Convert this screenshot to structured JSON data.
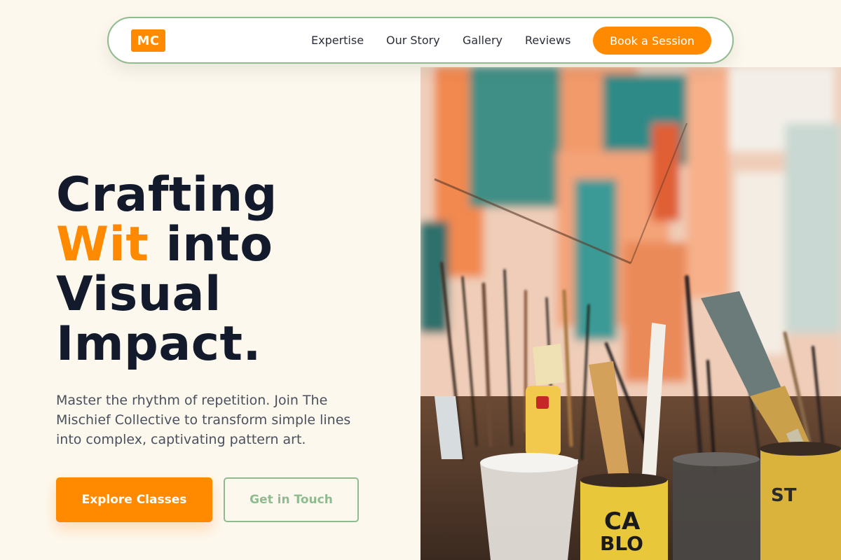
{
  "nav": {
    "logo_text": "MC",
    "links": [
      "Expertise",
      "Our Story",
      "Gallery",
      "Reviews"
    ],
    "cta_label": "Book a Session"
  },
  "hero": {
    "headline": {
      "line1": "Crafting",
      "accent": "Wit",
      "line2_rest": " into",
      "line3": "Visual",
      "line4": "Impact."
    },
    "subheading": "Master the rhythm of repetition. Join The Mischief Collective to transform simple lines into complex, captivating pattern art.",
    "primary_button": "Explore Classes",
    "secondary_button": "Get in Touch",
    "image_icon": "art-studio-brushes-image"
  },
  "colors": {
    "background": "#fdf8ee",
    "accent": "#ff8a00",
    "sage": "#8fbb8f",
    "text_dark": "#131a2b"
  }
}
